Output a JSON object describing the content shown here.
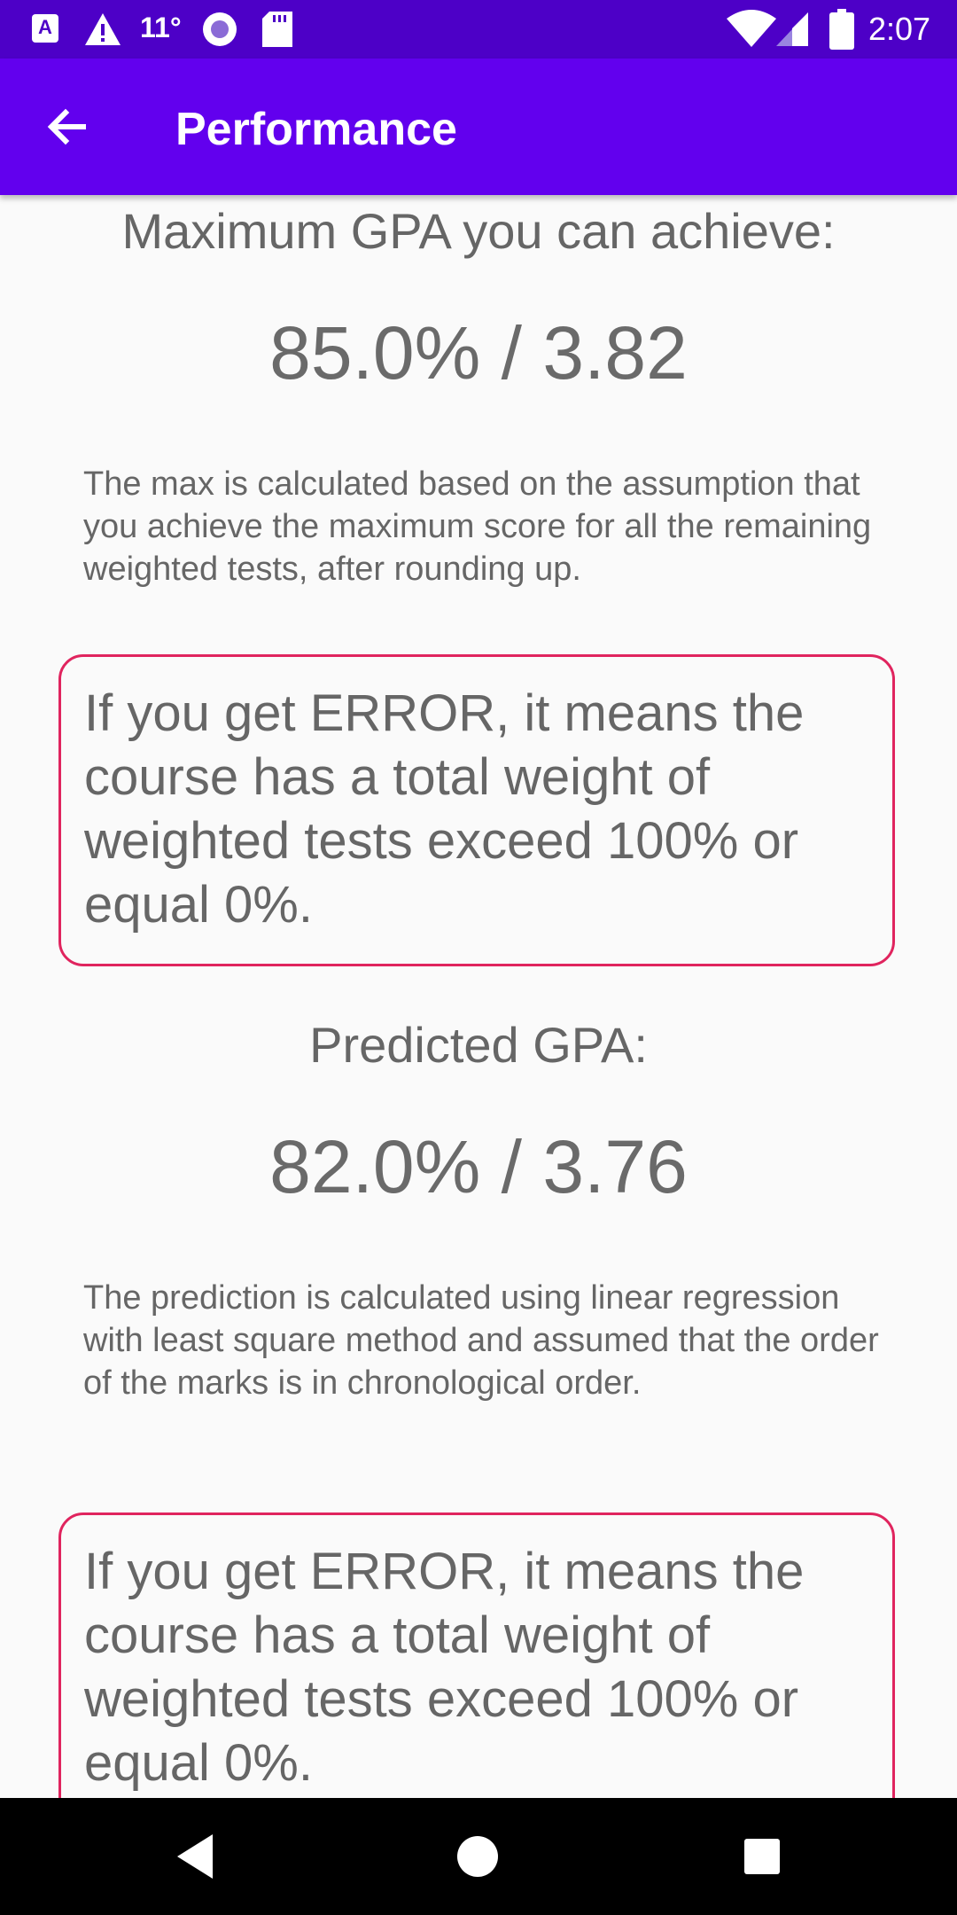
{
  "status_bar": {
    "notif_a_icon": "A",
    "temperature": "11°",
    "time": "2:07"
  },
  "app_bar": {
    "title": "Performance"
  },
  "max_section": {
    "heading": "Maximum GPA you can achieve:",
    "value": "85.0% / 3.82",
    "description": "The max is calculated based on the assumption that you achieve the maximum score for all the remaining weighted tests, after rounding up.",
    "warning": "If you get ERROR, it means the course has a total weight of weighted tests exceed 100% or equal 0%."
  },
  "predicted_section": {
    "heading": "Predicted GPA:",
    "value": "82.0% / 3.76",
    "description": "The prediction is calculated using linear regression with least square method and assumed that the order of the marks is in chronological order.",
    "warning": "If you get ERROR, it means the course has a total weight of weighted tests exceed 100% or equal 0%."
  },
  "colors": {
    "status_bar": "#4d00c7",
    "app_bar": "#6200ee",
    "warning_border": "#e0245e"
  }
}
